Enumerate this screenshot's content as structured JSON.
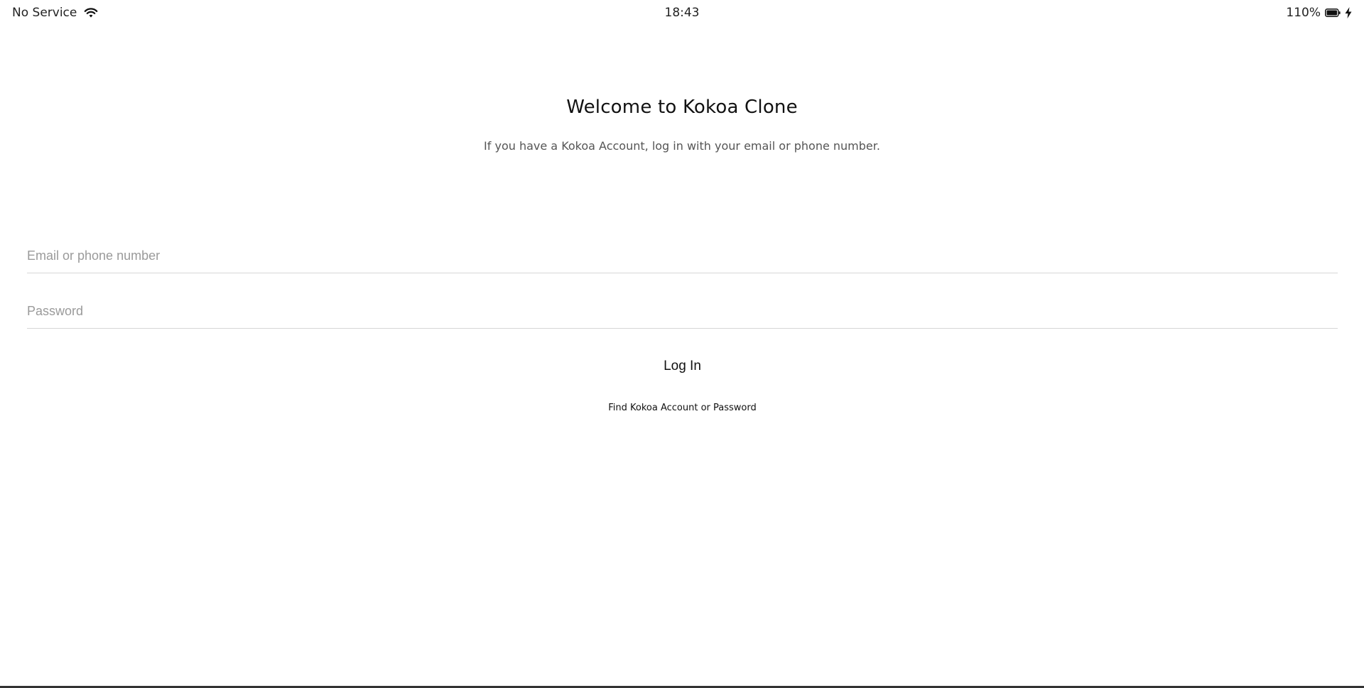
{
  "status_bar": {
    "carrier": "No Service",
    "time": "18:43",
    "battery": "110%",
    "icons": [
      "wifi-icon",
      "battery-icon",
      "charging-bolt-icon"
    ]
  },
  "header": {
    "title": "Welcome to Kokoa Clone",
    "subtitle": "If you have a Kokoa Account, log in with your email or phone number."
  },
  "login_form": {
    "email_field": {
      "value": "",
      "placeholder": "Email or phone number"
    },
    "password_field": {
      "value": "",
      "placeholder": "Password"
    },
    "submit_label": "Log In",
    "find_link": "Find Kokoa Account or Password"
  },
  "colors": {
    "background": "#ffffff",
    "text": "#111111",
    "subtitle": "#555555",
    "placeholder": "#9a9a9a",
    "divider": "#d6d6d6"
  }
}
